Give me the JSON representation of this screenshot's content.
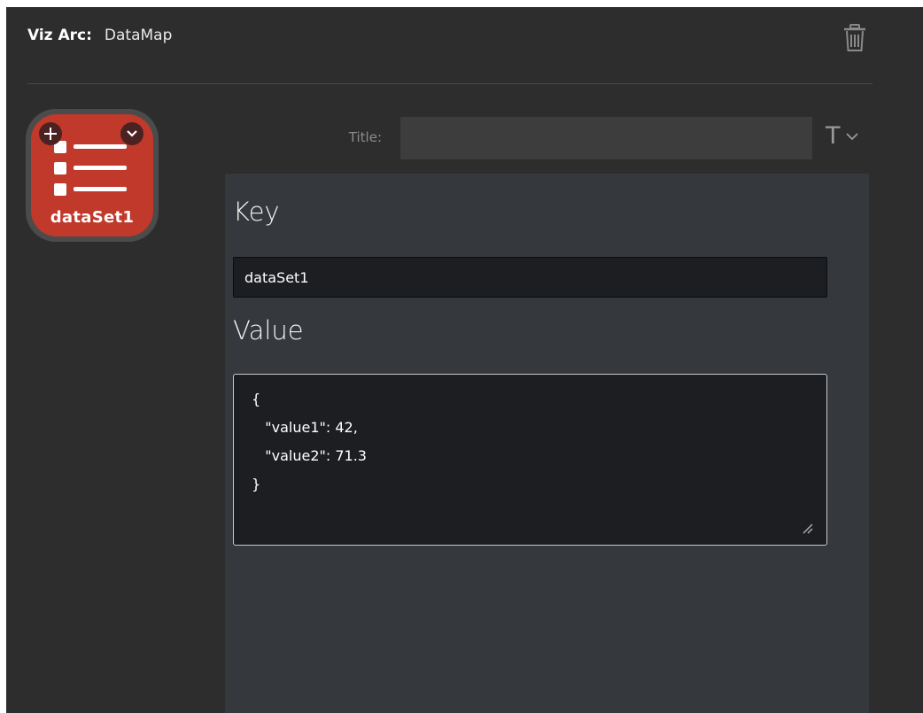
{
  "header": {
    "label": "Viz Arc:",
    "name": "DataMap",
    "delete_icon": "trash-icon"
  },
  "tile": {
    "label": "dataSet1",
    "icon": "list-icon",
    "add_icon": "plus-icon",
    "dropdown_icon": "chevron-down-icon",
    "color": "#c0392b"
  },
  "title_field": {
    "label": "Title:",
    "value": "",
    "type_menu_glyph": "T",
    "type_menu_icon": "chevron-down-icon"
  },
  "editor": {
    "key_heading": "Key",
    "key_value": "dataSet1",
    "value_heading": "Value",
    "value_text": "{\n   \"value1\": 42,\n   \"value2\": 71.3\n}"
  },
  "colors": {
    "background": "#2d2d2d",
    "panel": "#35383d",
    "field": "#1c1e22",
    "accent": "#c0392b"
  }
}
